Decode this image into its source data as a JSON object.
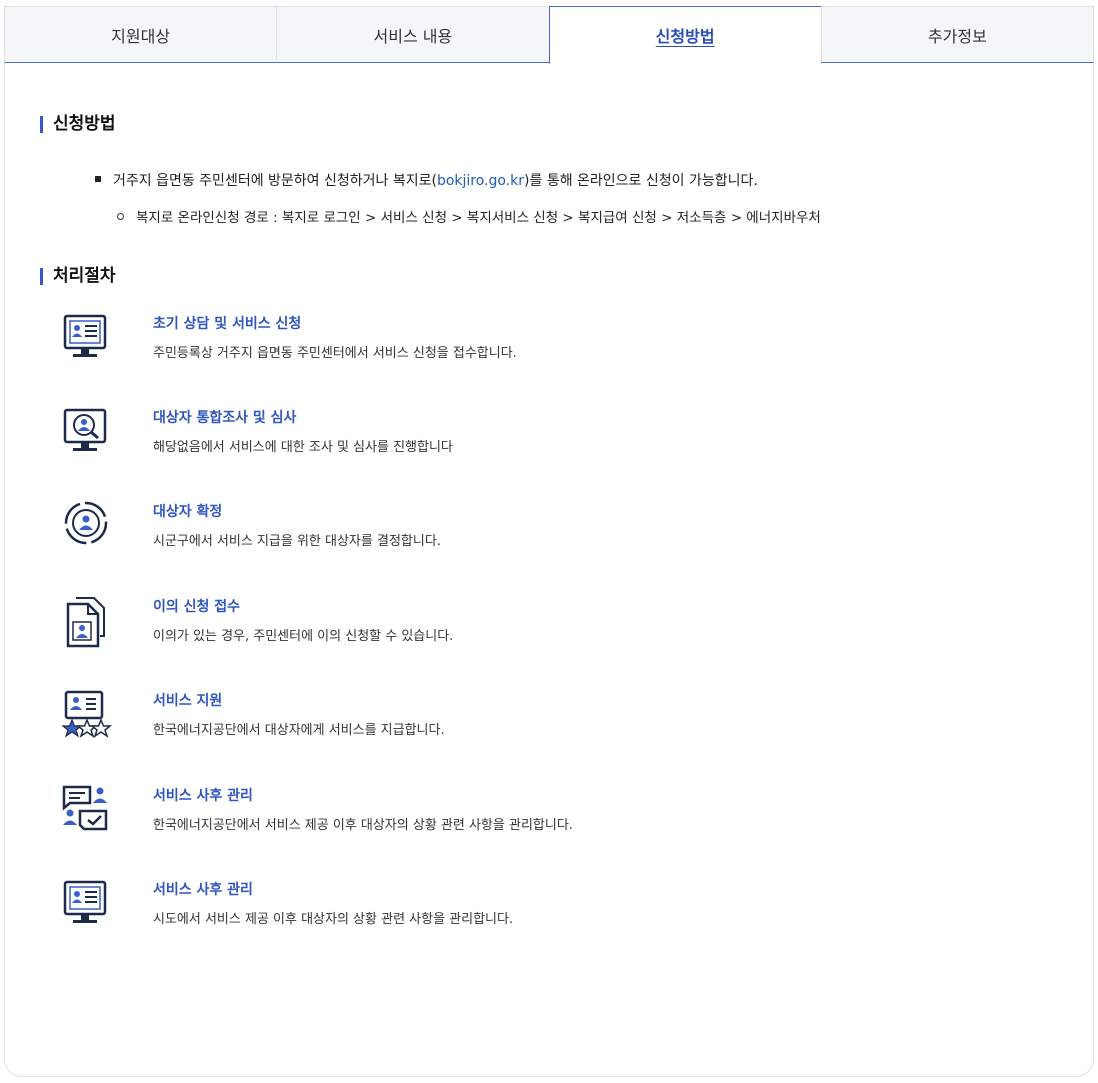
{
  "tabs": [
    {
      "label": "지원대상",
      "active": false
    },
    {
      "label": "서비스 내용",
      "active": false
    },
    {
      "label": "신청방법",
      "active": true
    },
    {
      "label": "추가정보",
      "active": false
    }
  ],
  "apply": {
    "title": "신청방법",
    "bullet_before": "거주지 읍면동 주민센터에 방문하여 신청하거나 복지로(",
    "bullet_link": "bokjiro.go.kr",
    "bullet_after": ")를 통해 온라인으로 신청이 가능합니다.",
    "sub_bullet": "복지로 온라인신청 경로 : 복지로 로그인 > 서비스 신청 > 복지서비스 신청 > 복지급여 신청 > 저소득층 > 에너지바우처"
  },
  "process": {
    "title": "처리절차",
    "steps": [
      {
        "icon": "computer-document-icon",
        "title": "초기 상담 및 서비스 신청",
        "desc": "주민등록상 거주지 읍면동 주민센터에서 서비스 신청을 접수합니다."
      },
      {
        "icon": "computer-search-user-icon",
        "title": "대상자 통합조사 및 심사",
        "desc": "해당없음에서 서비스에 대한 조사 및 심사를 진행합니다"
      },
      {
        "icon": "target-user-icon",
        "title": "대상자 확정",
        "desc": "시군구에서 서비스 지급을 위한 대상자를 결정합니다."
      },
      {
        "icon": "document-user-icon",
        "title": "이의 신청 접수",
        "desc": "이의가 있는 경우, 주민센터에 이의 신청할 수 있습니다."
      },
      {
        "icon": "profile-stars-icon",
        "title": "서비스 지원",
        "desc": "한국에너지공단에서 대상자에게 서비스를 지급합니다."
      },
      {
        "icon": "chat-check-users-icon",
        "title": "서비스 사후 관리",
        "desc": "한국에너지공단에서 서비스 제공 이후 대상자의 상황 관련 사항을 관리합니다."
      },
      {
        "icon": "computer-document-icon",
        "title": "서비스 사후 관리",
        "desc": "시도에서 서비스 제공 이후 대상자의 상황 관련 사항을 관리합니다."
      }
    ]
  },
  "colors": {
    "accent": "#2f55c0",
    "icon_dark": "#1e2a4a",
    "icon_blue": "#3a5fc8"
  }
}
